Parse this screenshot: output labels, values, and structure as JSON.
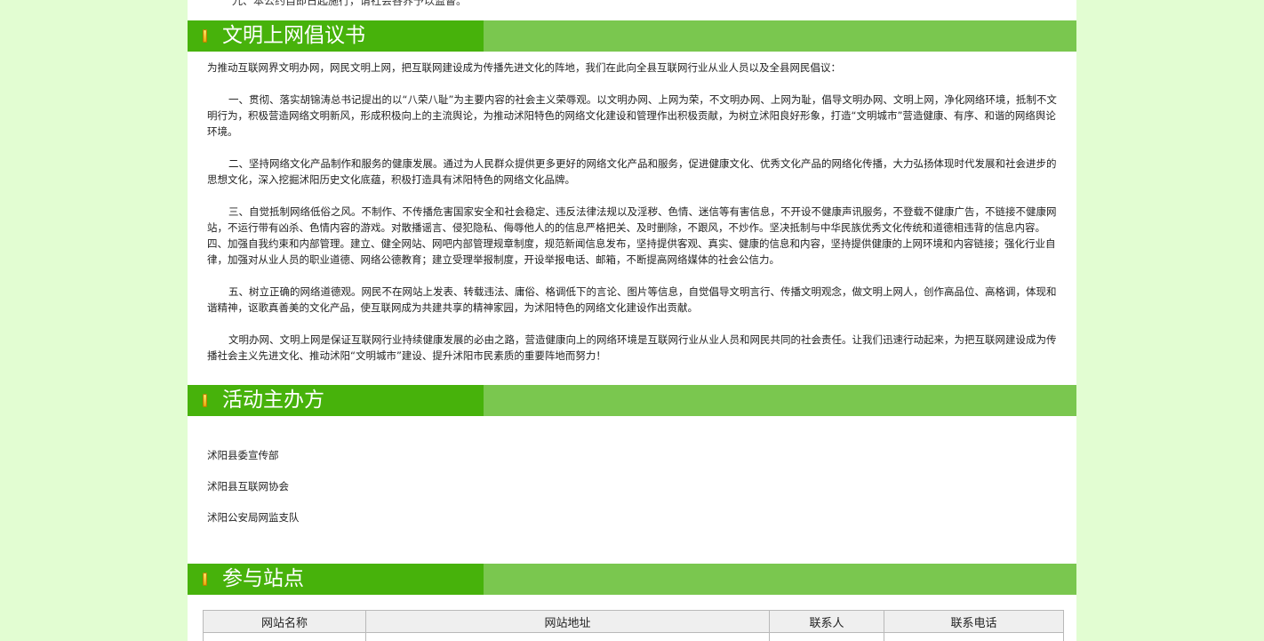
{
  "top_clipped_text": "九、本公约自即日起施行，请社会各界予以监督。",
  "sections": {
    "initiative": {
      "title": "文明上网倡议书",
      "intro": "为推动互联网界文明办网，网民文明上网，把互联网建设成为传播先进文化的阵地，我们在此向全县互联网行业从业人员以及全县网民倡议：",
      "para1": "一、贯彻、落实胡锦涛总书记提出的以“八荣八耻”为主要内容的社会主义荣辱观。以文明办网、上网为荣，不文明办网、上网为耻，倡导文明办网、文明上网，净化网络环境，抵制不文明行为，积极营造网络文明新风，形成积极向上的主流舆论，为推动沭阳特色的网络文化建设和管理作出积极贡献，为树立沭阳良好形象，打造“文明城市”营造健康、有序、和谐的网络舆论环境。",
      "para2": "二、坚持网络文化产品制作和服务的健康发展。通过为人民群众提供更多更好的网络文化产品和服务，促进健康文化、优秀文化产品的网络化传播，大力弘扬体现时代发展和社会进步的思想文化，深入挖掘沭阳历史文化底蕴，积极打造具有沭阳特色的网络文化品牌。",
      "para3": "三、自觉抵制网络低俗之风。不制作、不传播危害国家安全和社会稳定、违反法律法规以及淫秽、色情、迷信等有害信息，不开设不健康声讯服务，不登载不健康广告，不链接不健康网站，不运行带有凶杀、色情内容的游戏。对散播谣言、侵犯隐私、侮辱他人的的信息严格把关、及时删除，不跟风，不炒作。坚决抵制与中华民族优秀文化传统和道德相违背的信息内容。",
      "para4": "四、加强自我约束和内部管理。建立、健全网站、网吧内部管理规章制度，规范新闻信息发布，坚持提供客观、真实、健康的信息和内容，坚持提供健康的上网环境和内容链接；强化行业自律，加强对从业人员的职业道德、网络公德教育；建立受理举报制度，开设举报电话、邮箱，不断提高网络媒体的社会公信力。",
      "para5": "五、树立正确的网络道德观。网民不在网站上发表、转载违法、庸俗、格调低下的言论、图片等信息，自觉倡导文明言行、传播文明观念，做文明上网人，创作高品位、高格调，体现和谐精神，讴歌真善美的文化产品，使互联网成为共建共享的精神家园，为沭阳特色的网络文化建设作出贡献。",
      "closing": "文明办网、文明上网是保证互联网行业持续健康发展的必由之路，营造健康向上的网络环境是互联网行业从业人员和网民共同的社会责任。让我们迅速行动起来，为把互联网建设成为传播社会主义先进文化、推动沭阳“文明城市”建设、提升沭阳市民素质的重要阵地而努力！"
    },
    "organizers": {
      "title": "活动主办方",
      "items": [
        "沭阳县委宣传部",
        "沭阳县互联网协会",
        "沭阳公安局网监支队"
      ]
    },
    "sites": {
      "title": "参与站点",
      "columns": [
        "网站名称",
        "网站地址",
        "联系人",
        "联系电话"
      ]
    }
  },
  "colors": {
    "background": "#e2fdd2",
    "header_dark": "#47b20b",
    "header_light": "#7ac74f",
    "header_icon": "#f5c400"
  },
  "icons": {
    "section_marker": "yellow-bar-icon"
  }
}
